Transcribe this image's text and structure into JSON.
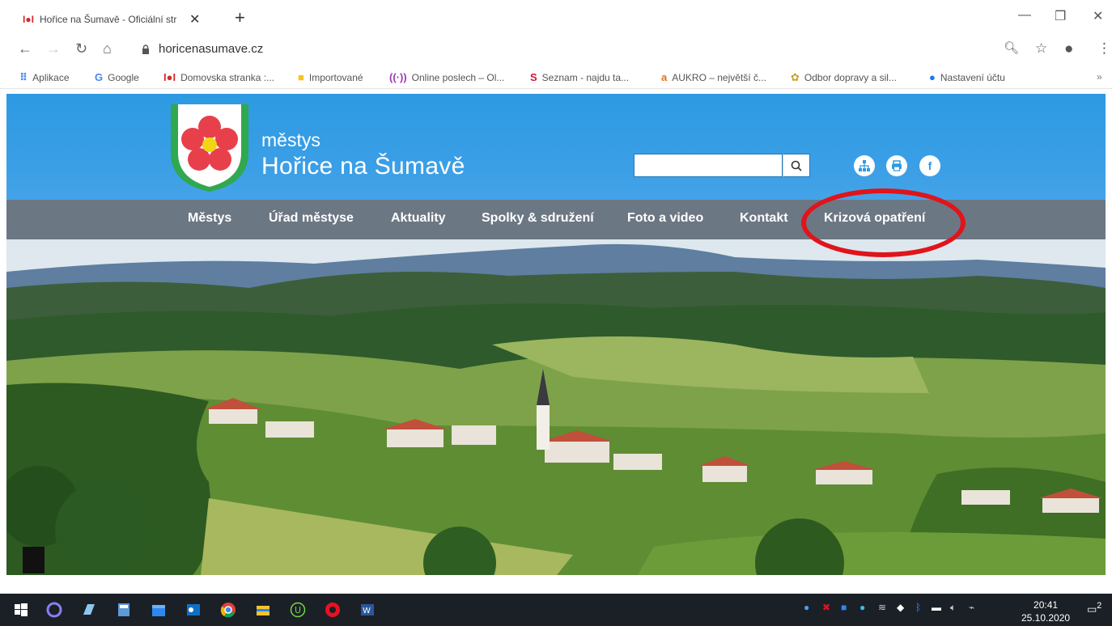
{
  "browser": {
    "tab_title": "Hořice na Šumavě - Oficiální str",
    "url": "horicenasumave.cz",
    "bookmarks": [
      {
        "label": "Aplikace"
      },
      {
        "label": "Google"
      },
      {
        "label": "Domovska stranka :..."
      },
      {
        "label": "Importované"
      },
      {
        "label": "Online poslech – Ol..."
      },
      {
        "label": "Seznam - najdu ta..."
      },
      {
        "label": "AUKRO – největší č..."
      },
      {
        "label": "Odbor dopravy a sil..."
      },
      {
        "label": "Nastavení účtu"
      }
    ],
    "bookmarks_more": "»"
  },
  "site": {
    "brand_small": "městys",
    "brand_big": "Hořice na Šumavě",
    "search_placeholder": "",
    "nav": [
      {
        "label": "Městys"
      },
      {
        "label": "Úřad městyse"
      },
      {
        "label": "Aktuality"
      },
      {
        "label": "Spolky & sdružení"
      },
      {
        "label": "Foto a video"
      },
      {
        "label": "Kontakt"
      },
      {
        "label": "Krizová opatření"
      }
    ]
  },
  "taskbar": {
    "time": "20:41",
    "date": "25.10.2020",
    "notifications": "2"
  },
  "colors": {
    "header_blue": "#2c9ae2",
    "nav_gray": "#6c7784",
    "highlight_red": "#e0141b"
  }
}
